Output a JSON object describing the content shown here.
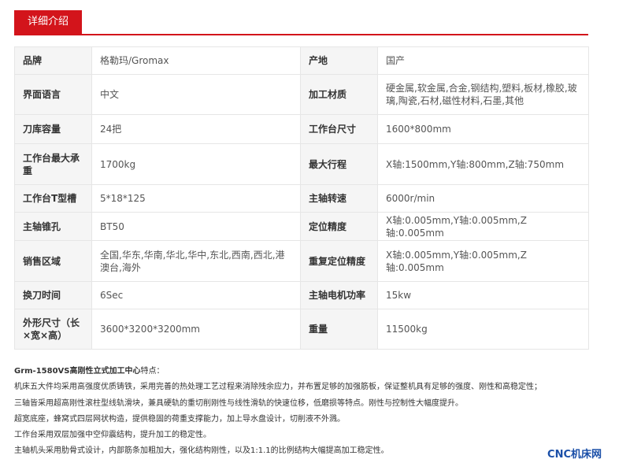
{
  "tab": {
    "label": "详细介绍"
  },
  "params": {
    "rows": [
      {
        "k1": "品牌",
        "v1": "格勒玛/Gromax",
        "k2": "产地",
        "v2": "国产"
      },
      {
        "k1": "界面语言",
        "v1": "中文",
        "k2": "加工材质",
        "v2": "硬金属,软金属,合金,钢结构,塑料,板材,橡胶,玻璃,陶瓷,石材,磁性材料,石墨,其他"
      },
      {
        "k1": "刀库容量",
        "v1": "24把",
        "k2": "工作台尺寸",
        "v2": "1600*800mm"
      },
      {
        "k1": "工作台最大承重",
        "v1": "1700kg",
        "k2": "最大行程",
        "v2": "X轴:1500mm,Y轴:800mm,Z轴:750mm"
      },
      {
        "k1": "工作台T型槽",
        "v1": "5*18*125",
        "k2": "主轴转速",
        "v2": "6000r/min"
      },
      {
        "k1": "主轴锥孔",
        "v1": "BT50",
        "k2": "定位精度",
        "v2": "X轴:0.005mm,Y轴:0.005mm,Z轴:0.005mm"
      },
      {
        "k1": "销售区域",
        "v1": "全国,华东,华南,华北,华中,东北,西南,西北,港澳台,海外",
        "k2": "重复定位精度",
        "v2": "X轴:0.005mm,Y轴:0.005mm,Z轴:0.005mm"
      },
      {
        "k1": "换刀时间",
        "v1": "6Sec",
        "k2": "主轴电机功率",
        "v2": "15kw"
      },
      {
        "k1": "外形尺寸（长×宽×高）",
        "v1": "3600*3200*3200mm",
        "k2": "重量",
        "v2": "11500kg"
      }
    ]
  },
  "features": {
    "title_bold": "Grm-1580VS高刚性立式加工中心",
    "title_suffix": "特点：",
    "lines": [
      "机床五大件均采用高强度优质铸铁，采用完善的热处理工艺过程来消除残余应力，并布置足够的加强筋板，保证整机具有足够的强度、刚性和高稳定性；",
      "三轴皆采用超高刚性滚柱型线轨滑块，兼具硬轨的重切削刚性与线性滑轨的快速位移，低磨损等特点。刚性与控制性大幅度提升。",
      "超宽底座，蜂窝式四层网状构造，提供稳固的荷重支撑能力，加上导水盘设计，切削液不外溅。",
      "工作台采用双层加强中空仰震结构，提升加工的稳定性。",
      "主轴机头采用肋骨式设计，内部筋条加粗加大，强化结构刚性，以及1:1.1的比例结构大幅提高加工稳定性。"
    ]
  },
  "watermark": "CNC机床网"
}
